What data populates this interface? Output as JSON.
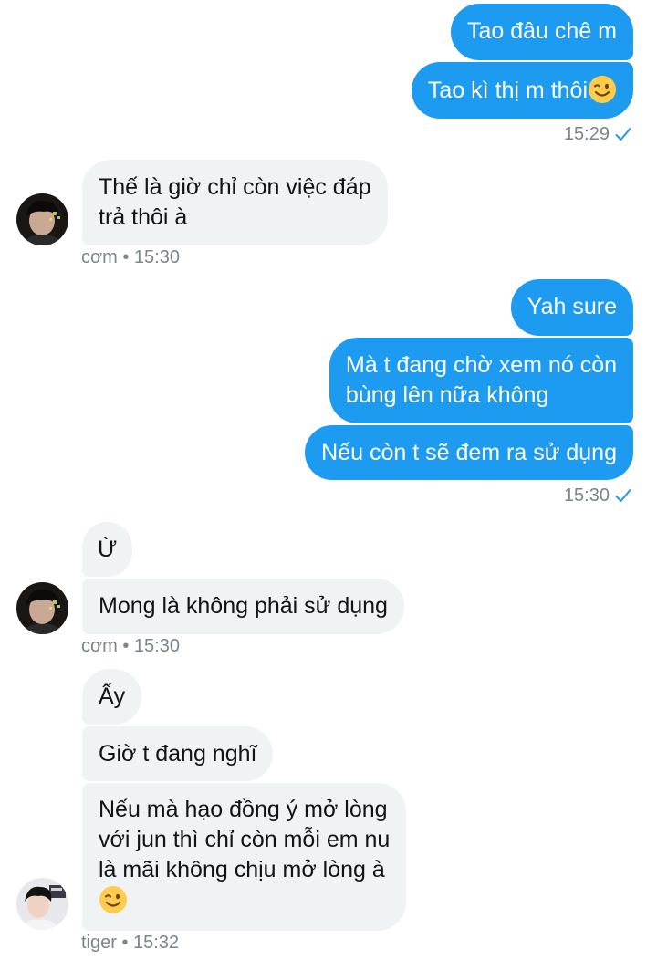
{
  "messages": {
    "m1": "Tao đâu chê m",
    "m2": "Tao kì thị m thôi",
    "m2_time": "15:29",
    "m3_line1": "Thế là giờ chỉ còn việc đáp",
    "m3_line2": "trả thôi à",
    "m3_meta": "cơm • 15:30",
    "m4": "Yah sure",
    "m5_line1": "Mà t đang chờ xem nó còn",
    "m5_line2": "bùng lên nữa không",
    "m6": "Nếu còn t sẽ đem ra sử dụng",
    "m6_time": "15:30",
    "m7": "Ừ",
    "m8": "Mong là không phải sử dụng",
    "m8_meta": "cơm • 15:30",
    "m9": "Ấy",
    "m10": "Giờ t đang nghĩ",
    "m11_line1": "Nếu mà hạo đồng ý mở lòng",
    "m11_line2": "với jun thì chỉ còn mỗi em nu",
    "m11_line3": "là mãi không chịu mở lòng à",
    "m11_meta": "tiger • 15:32"
  },
  "colors": {
    "outgoing_bubble": "#1d9bf0",
    "incoming_bubble": "#eff3f4",
    "meta_text": "#7b858e",
    "read_check": "#1d9bf0"
  },
  "icons": {
    "emoji": "winking-face",
    "receipt": "single-check-read"
  }
}
